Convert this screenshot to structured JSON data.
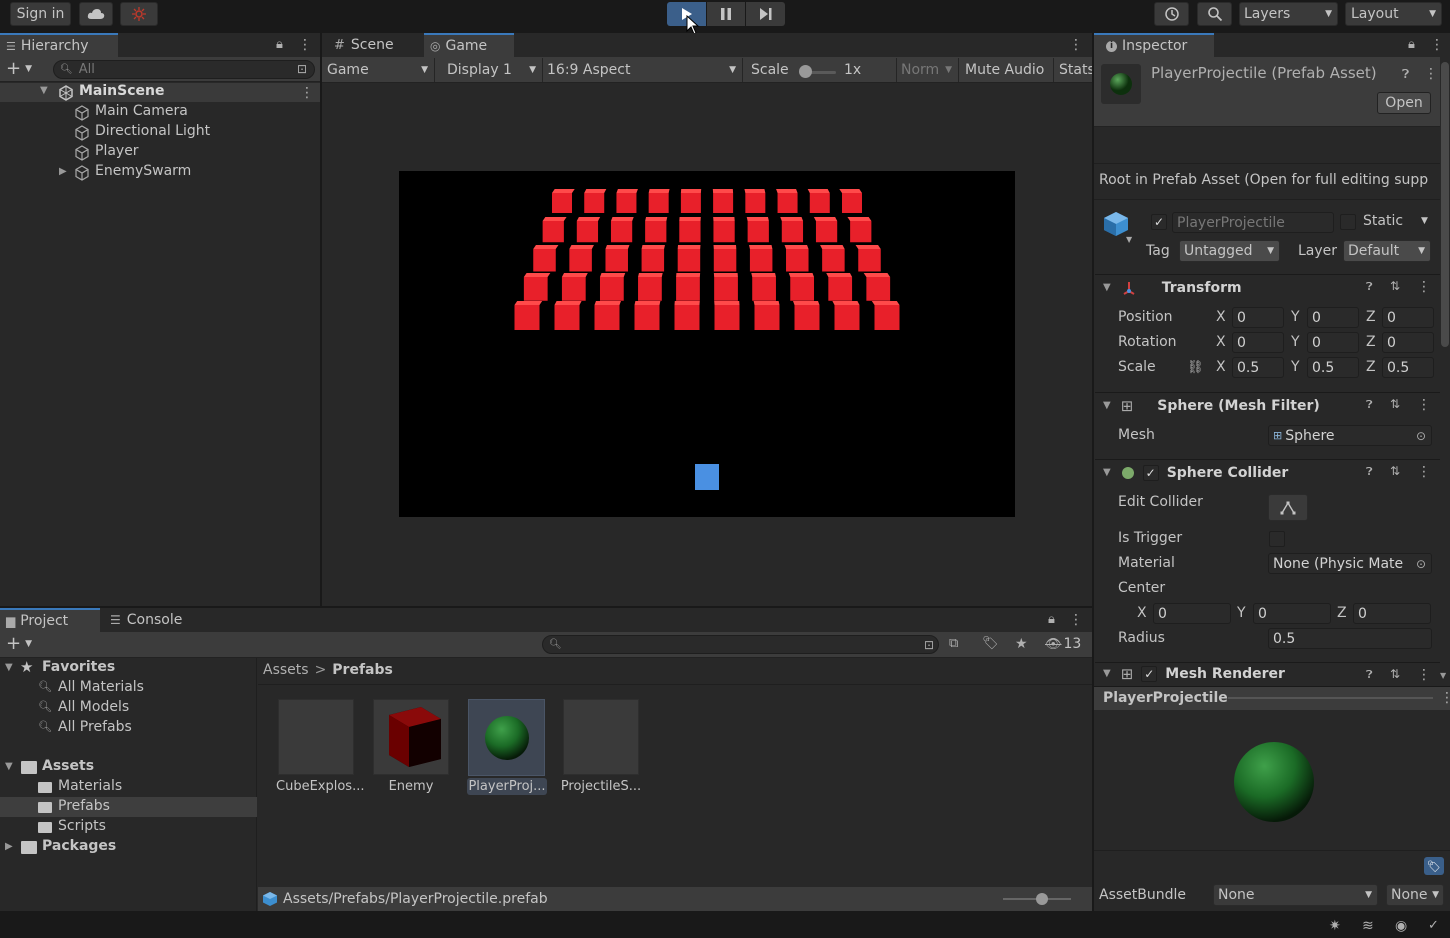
{
  "toolbar": {
    "sign_in": "Sign in",
    "layers": "Layers",
    "layout": "Layout"
  },
  "hierarchy": {
    "tab": "Hierarchy",
    "search_placeholder": "All",
    "scene": "MainScene",
    "items": [
      "Main Camera",
      "Directional Light",
      "Player",
      "EnemySwarm"
    ]
  },
  "game_view": {
    "tabs": [
      "Scene",
      "Game"
    ],
    "mode": "Game",
    "display": "Display 1",
    "aspect": "16:9 Aspect",
    "scale_label": "Scale",
    "scale_value": "1x",
    "norm": "Norm",
    "mute": "Mute Audio",
    "stats": "Stats",
    "enemy_rows": 5,
    "enemy_cols": 10,
    "colors": {
      "enemy": "#e8202a",
      "player": "#4a90e2",
      "viewport": "#000000"
    }
  },
  "inspector": {
    "tab": "Inspector",
    "asset_title": "PlayerProjectile (Prefab Asset)",
    "open_button": "Open",
    "root_note": "Root in Prefab Asset (Open for full editing supp",
    "object_name": "PlayerProjectile",
    "static_label": "Static",
    "tag_label": "Tag",
    "tag_value": "Untagged",
    "layer_label": "Layer",
    "layer_value": "Default",
    "transform": {
      "title": "Transform",
      "position_label": "Position",
      "rotation_label": "Rotation",
      "scale_label": "Scale",
      "position": {
        "x": "0",
        "y": "0",
        "z": "0"
      },
      "rotation": {
        "x": "0",
        "y": "0",
        "z": "0"
      },
      "scale": {
        "x": "0.5",
        "y": "0.5",
        "z": "0.5"
      }
    },
    "mesh_filter": {
      "title": "Sphere (Mesh Filter)",
      "mesh_label": "Mesh",
      "mesh_value": "Sphere"
    },
    "collider": {
      "title": "Sphere Collider",
      "edit_label": "Edit Collider",
      "trigger_label": "Is Trigger",
      "material_label": "Material",
      "material_value": "None (Physic Mate",
      "center_label": "Center",
      "center": {
        "x": "0",
        "y": "0",
        "z": "0"
      },
      "radius_label": "Radius",
      "radius_value": "0.5"
    },
    "renderer": {
      "title": "Mesh Renderer"
    },
    "preview_title": "PlayerProjectile",
    "assetbundle_label": "AssetBundle",
    "assetbundle_value": "None",
    "assetbundle_variant": "None",
    "axis": {
      "x": "X",
      "y": "Y",
      "z": "Z"
    }
  },
  "project": {
    "tabs": [
      "Project",
      "Console"
    ],
    "hidden_count": "13",
    "favorites_label": "Favorites",
    "favorites": [
      "All Materials",
      "All Models",
      "All Prefabs"
    ],
    "assets_label": "Assets",
    "folders": [
      "Materials",
      "Prefabs",
      "Scripts"
    ],
    "packages_label": "Packages",
    "breadcrumb": [
      "Assets",
      "Prefabs"
    ],
    "files": [
      "CubeExplos...",
      "Enemy",
      "PlayerProj...",
      "ProjectileS..."
    ],
    "path": "Assets/Prefabs/PlayerProjectile.prefab"
  }
}
